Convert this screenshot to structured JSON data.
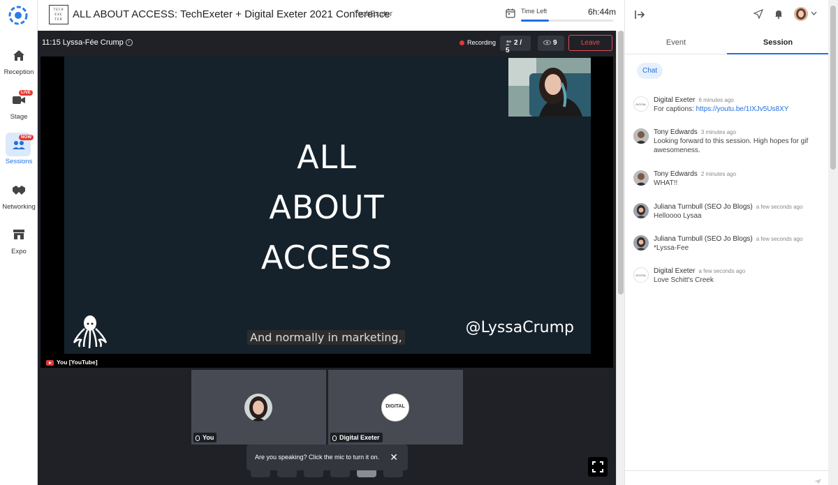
{
  "nav": {
    "items": [
      {
        "label": "Reception"
      },
      {
        "label": "Stage",
        "badge": "LIVE"
      },
      {
        "label": "Sessions",
        "badge": "NOW"
      },
      {
        "label": "Networking"
      },
      {
        "label": "Expo"
      }
    ]
  },
  "header": {
    "brand_text": [
      "TECH",
      "EXE",
      "TER"
    ],
    "title": "ALL ABOUT ACCESS: TechExeter + Digital Exeter 2021 Conference",
    "organizer": "TechExeter",
    "timer_label": "Time Left",
    "timer_value": "6h:44m",
    "timer_progress": 0.3
  },
  "stage": {
    "session_time_speaker": "11:15 Lyssa-Fée Crump",
    "recording_label": "Recording",
    "participants": "2 / 5",
    "viewers": "9",
    "leave_label": "Leave",
    "slide_title_lines": [
      "ALL",
      "ABOUT",
      "ACCESS"
    ],
    "slide_handle": "@LyssaCrump",
    "caption": "And normally in marketing,",
    "source_label": "You [YouTube]",
    "tiles": [
      {
        "label": "You"
      },
      {
        "label": "Digital Exeter",
        "avatar_text": "DIGITAL"
      }
    ],
    "toast_text": "Are you speaking? Click the mic to turn it on."
  },
  "panel": {
    "tabs": [
      "Event",
      "Session"
    ],
    "active_tab": "Session",
    "chat_label": "Chat",
    "messages": [
      {
        "name": "Digital Exeter",
        "time": "6 minutes ago",
        "prefix": "For captions: ",
        "link": "https://youtu.be/1IXJv5Us8XY",
        "text": ""
      },
      {
        "name": "Tony Edwards",
        "time": "3 minutes ago",
        "prefix": "",
        "link": "",
        "text": "Looking forward to this session. High hopes for gif awesomeness."
      },
      {
        "name": "Tony Edwards",
        "time": "2 minutes ago",
        "prefix": "",
        "link": "",
        "text": "WHAT!!"
      },
      {
        "name": "Juliana Turnbull (SEO Jo Blogs)",
        "time": "a few seconds ago",
        "prefix": "",
        "link": "",
        "text": "Helloooo Lysaa"
      },
      {
        "name": "Juliana Turnbull (SEO Jo Blogs)",
        "time": "a few seconds ago",
        "prefix": "",
        "link": "",
        "text": "*Lyssa-Fee"
      },
      {
        "name": "Digital Exeter",
        "time": "a few seconds ago",
        "prefix": "",
        "link": "",
        "text": "Love Schitt's Creek"
      }
    ]
  },
  "colors": {
    "accent": "#1f6fe0",
    "stage_bg": "#1f2127",
    "slide_bg": "#15222c",
    "danger": "#e05050"
  }
}
